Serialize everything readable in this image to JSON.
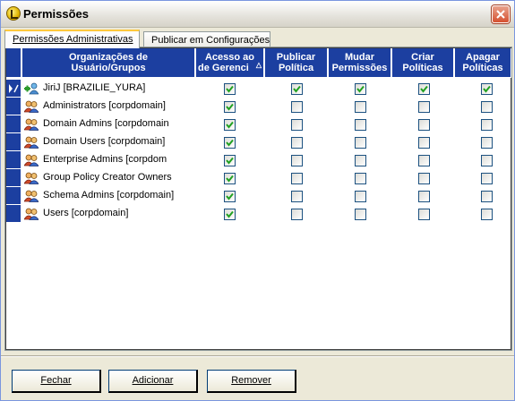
{
  "window": {
    "title": "Permissões"
  },
  "tabs": [
    {
      "label": "Permissões Administrativas",
      "active": true
    },
    {
      "label": "Publicar em Configurações",
      "active": false
    }
  ],
  "grid": {
    "columns": [
      {
        "line1": "Organizações de",
        "line2": "Usuário/Grupos"
      },
      {
        "line1": "Acesso ao",
        "line2": "de Gerenci"
      },
      {
        "line1": "Publicar",
        "line2": "Política"
      },
      {
        "line1": "Mudar",
        "line2": "Permissões"
      },
      {
        "line1": "Criar",
        "line2": "Políticas"
      },
      {
        "line1": "Apagar",
        "line2": "Políticas"
      }
    ],
    "sort_indicator": "△",
    "rows": [
      {
        "name": "JiriJ [BRAZILIE_YURA]",
        "icon": "user-add-icon",
        "checks": [
          true,
          true,
          true,
          true,
          true
        ],
        "current": true
      },
      {
        "name": "Administrators [corpdomain]",
        "icon": "group-icon",
        "checks": [
          true,
          false,
          false,
          false,
          false
        ]
      },
      {
        "name": "Domain Admins [corpdomain",
        "icon": "group-icon",
        "checks": [
          true,
          false,
          false,
          false,
          false
        ]
      },
      {
        "name": "Domain Users [corpdomain]",
        "icon": "group-icon",
        "checks": [
          true,
          false,
          false,
          false,
          false
        ]
      },
      {
        "name": "Enterprise Admins [corpdom",
        "icon": "group-icon",
        "checks": [
          true,
          false,
          false,
          false,
          false
        ]
      },
      {
        "name": "Group Policy Creator Owners",
        "icon": "group-icon",
        "checks": [
          true,
          false,
          false,
          false,
          false
        ]
      },
      {
        "name": "Schema Admins [corpdomain]",
        "icon": "group-icon",
        "checks": [
          true,
          false,
          false,
          false,
          false
        ]
      },
      {
        "name": "Users [corpdomain]",
        "icon": "group-icon",
        "checks": [
          true,
          false,
          false,
          false,
          false
        ]
      }
    ]
  },
  "buttons": {
    "close": "Fechar",
    "add": "Adicionar",
    "remove": "Remover"
  },
  "colors": {
    "header_bg": "#1c3fa0",
    "check": "#21a121"
  }
}
